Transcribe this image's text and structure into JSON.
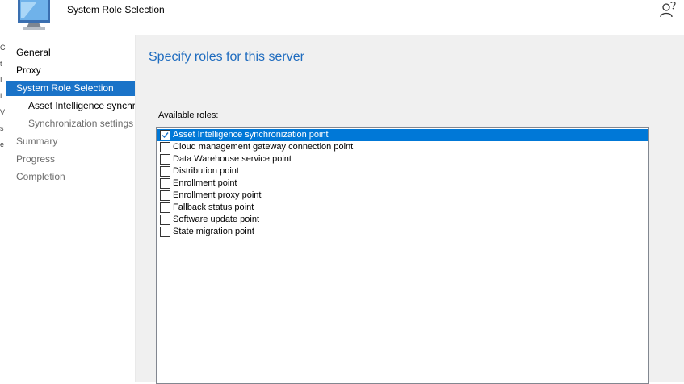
{
  "header": {
    "title": "System Role Selection",
    "app_icon": "computer-monitor-icon",
    "help_icon": "person-question-icon"
  },
  "left_edge": {
    "fragments": [
      "Co",
      "t",
      "I",
      "L",
      "V",
      "s",
      "e"
    ]
  },
  "nav": {
    "items": [
      {
        "label": "General"
      },
      {
        "label": "Proxy"
      },
      {
        "label": "System Role Selection"
      },
      {
        "label": "Asset Intelligence synchronization point"
      },
      {
        "label": "Synchronization settings"
      },
      {
        "label": "Summary"
      },
      {
        "label": "Progress"
      },
      {
        "label": "Completion"
      }
    ]
  },
  "main": {
    "heading": "Specify roles for this server",
    "roles_label": "Available roles:",
    "roles": [
      {
        "label": "Asset Intelligence synchronization point",
        "checked": true,
        "selected": true
      },
      {
        "label": "Cloud management gateway connection point",
        "checked": false,
        "selected": false
      },
      {
        "label": "Data Warehouse service point",
        "checked": false,
        "selected": false
      },
      {
        "label": "Distribution point",
        "checked": false,
        "selected": false
      },
      {
        "label": "Enrollment point",
        "checked": false,
        "selected": false
      },
      {
        "label": "Enrollment proxy point",
        "checked": false,
        "selected": false
      },
      {
        "label": "Fallback status point",
        "checked": false,
        "selected": false
      },
      {
        "label": "Software update point",
        "checked": false,
        "selected": false
      },
      {
        "label": "State migration point",
        "checked": false,
        "selected": false
      }
    ]
  },
  "colors": {
    "nav_active": "#1a73c8",
    "heading": "#1f6cbf",
    "selected_row": "#0078d7",
    "content_bg": "#f0f0f0"
  }
}
